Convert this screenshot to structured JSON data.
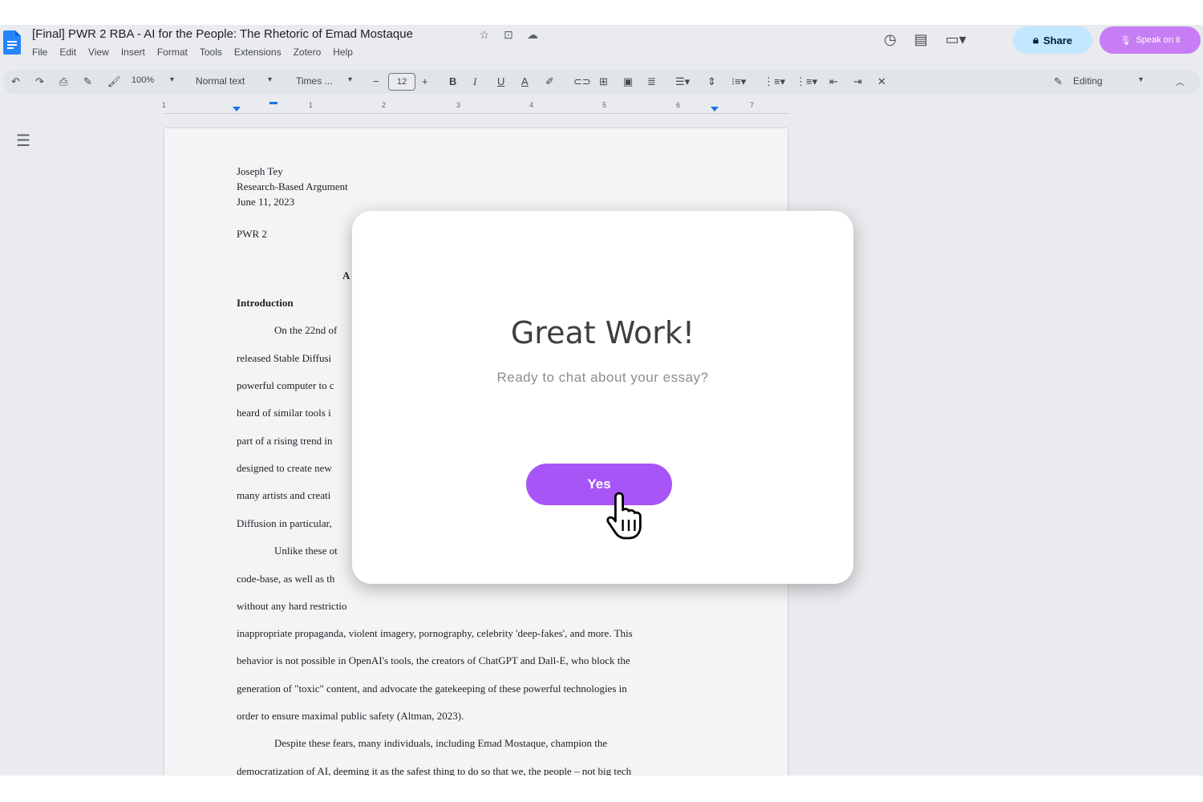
{
  "header": {
    "doc_title": "[Final] PWR 2 RBA - AI for the People: The Rhetoric of Emad Mostaque",
    "menu": [
      "File",
      "Edit",
      "View",
      "Insert",
      "Format",
      "Tools",
      "Extensions",
      "Zotero",
      "Help"
    ],
    "share_label": "Share",
    "speak_label": "Speak on it"
  },
  "toolbar": {
    "zoom": "100%",
    "style": "Normal text",
    "font": "Times ...",
    "font_size": "12",
    "mode": "Editing"
  },
  "ruler": {
    "numbers": [
      "1",
      "1",
      "2",
      "3",
      "4",
      "5",
      "6",
      "7"
    ]
  },
  "document": {
    "header_lines": [
      "Joseph Tey",
      "Research-Based Argument",
      "June 11, 2023"
    ],
    "class_line": "PWR 2",
    "title_fragment": "A",
    "section_heading": "Introduction",
    "left_fragments": [
      "On the 22nd of",
      "released Stable Diffusi",
      "powerful computer to c",
      "heard of similar tools i",
      "part of a rising trend in",
      "designed to create new",
      "many artists and creati",
      "Diffusion in particular,",
      "Unlike these ot",
      "code-base, as well as th",
      "without any hard restrictio"
    ],
    "full_lines": [
      "inappropriate propaganda, violent imagery, pornography, celebrity 'deep-fakes', and more. This",
      "behavior is not possible in OpenAI's tools, the creators of ChatGPT and Dall-E, who block the",
      "generation of \"toxic\" content, and advocate the gatekeeping of these powerful technologies in",
      "order to ensure maximal public safety (Altman, 2023).",
      "Despite these fears, many individuals, including Emad Mostaque, champion the",
      "democratization of AI, deeming it as the safest thing to do so that we, the people – not big tech"
    ]
  },
  "modal": {
    "title": "Great Work!",
    "subtitle": "Ready to chat about your essay?",
    "button_label": "Yes"
  },
  "colors": {
    "accent_purple": "#a855f7",
    "speak_button": "#c77df3",
    "share_button": "#c2e7ff",
    "docs_blue": "#2684fc"
  }
}
